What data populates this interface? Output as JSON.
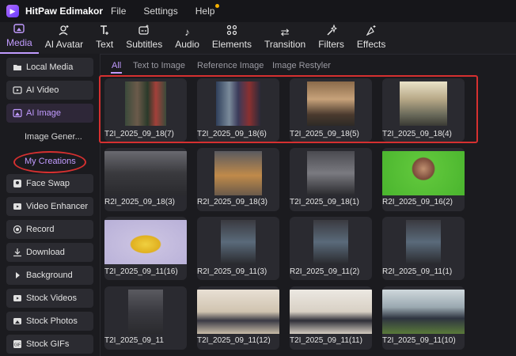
{
  "titlebar": {
    "app_name": "HitPaw Edimakor",
    "menus": [
      "File",
      "Settings",
      "Help"
    ]
  },
  "toolbar": {
    "tools": [
      {
        "label": "Media",
        "icon": "media-icon",
        "active": true
      },
      {
        "label": "AI Avatar",
        "icon": "avatar-icon"
      },
      {
        "label": "Text",
        "icon": "text-icon"
      },
      {
        "label": "Subtitles",
        "icon": "subtitles-icon"
      },
      {
        "label": "Audio",
        "icon": "music-icon"
      },
      {
        "label": "Elements",
        "icon": "elements-icon"
      },
      {
        "label": "Transition",
        "icon": "transition-icon"
      },
      {
        "label": "Filters",
        "icon": "filters-icon"
      },
      {
        "label": "Effects",
        "icon": "effects-icon"
      }
    ]
  },
  "sidebar": {
    "items": [
      {
        "label": "Local Media",
        "icon": "folder-icon"
      },
      {
        "label": "AI Video",
        "icon": "video-icon"
      },
      {
        "label": "AI Image",
        "icon": "image-icon",
        "active": true
      },
      {
        "label": "Face Swap",
        "icon": "face-swap-icon"
      },
      {
        "label": "Video Enhancer",
        "icon": "enhancer-icon"
      },
      {
        "label": "Record",
        "icon": "record-icon"
      },
      {
        "label": "Download",
        "icon": "download-icon"
      },
      {
        "label": "Background",
        "icon": "background-icon"
      },
      {
        "label": "Stock Videos",
        "icon": "stock-video-icon"
      },
      {
        "label": "Stock Photos",
        "icon": "stock-photo-icon"
      },
      {
        "label": "Stock GIFs",
        "icon": "gif-icon"
      }
    ],
    "subitems": [
      {
        "label": "Image Gener..."
      },
      {
        "label": "My Creations",
        "selected": true
      }
    ]
  },
  "tabs": [
    "All",
    "Text to Image",
    "Reference Image",
    "Image Restyler"
  ],
  "grid": {
    "items": [
      "T2I_2025_09_18(7)",
      "T2I_2025_09_18(6)",
      "T2I_2025_09_18(5)",
      "T2I_2025_09_18(4)",
      "R2I_2025_09_18(3)",
      "R2I_2025_09_18(3)",
      "T2I_2025_09_18(1)",
      "R2I_2025_09_16(2)",
      "T2I_2025_09_11(16)",
      "R2I_2025_09_11(3)",
      "R2I_2025_09_11(2)",
      "R2I_2025_09_11(1)",
      "T2I_2025_09_11",
      "T2I_2025_09_11(12)",
      "T2I_2025_09_11(11)",
      "T2I_2025_09_11(10)"
    ]
  },
  "colors": {
    "accent": "#c19bff",
    "highlight": "#d63030",
    "background": "#1b1b1f"
  }
}
